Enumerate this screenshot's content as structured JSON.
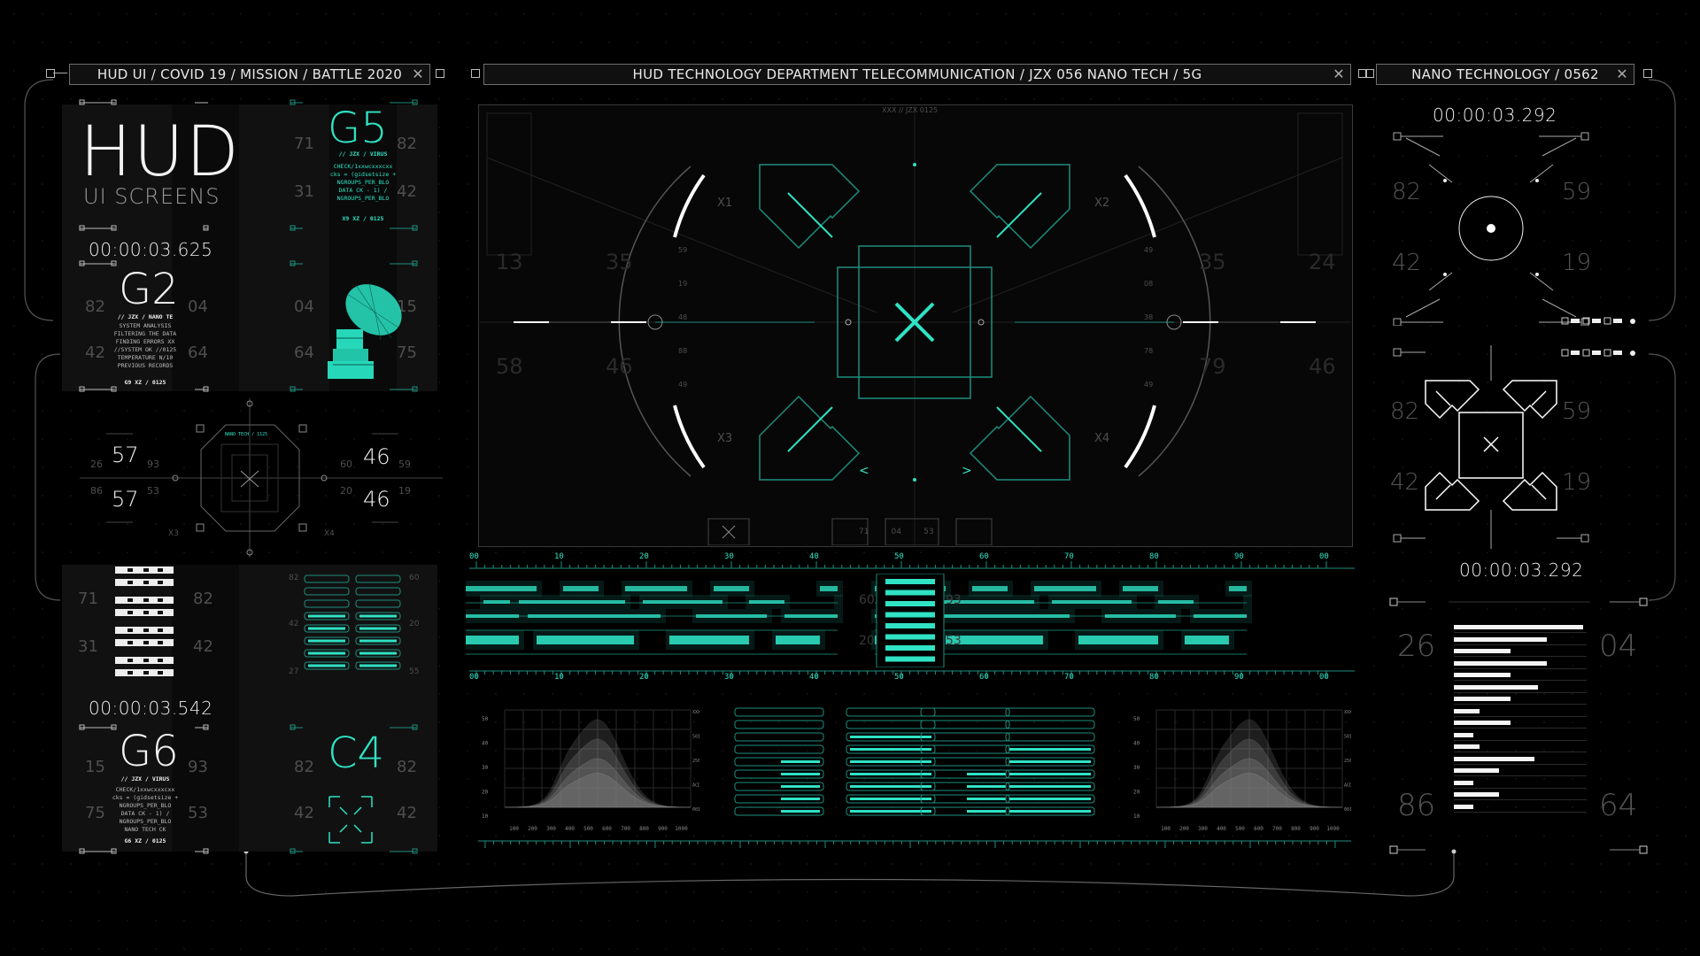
{
  "colors": {
    "accent": "#2fe3c4",
    "background": "#000000",
    "panel": "#111111",
    "text": "#e8e8e8",
    "muted": "#555555"
  },
  "top_bars": {
    "left": "HUD UI / COVID 19 /   MISSION / BATTLE 2020",
    "center": "HUD TECHNOLOGY  DEPARTMENT  TELECOMMUNICATION    /  JZX 056 NANO TECH / 5G",
    "right": "NANO TECHNOLOGY / 0562"
  },
  "left_panel_1": {
    "hud_title": "HUD",
    "hud_subtitle": "UI SCREENS",
    "g5_code": "G5",
    "g5_tag": "// JZX / VIRUS",
    "g5_lines": [
      "CHECK/1xxwcxxxcxx",
      "cks = (gidsetsize +",
      "NGROUPS_PER_BLO",
      "DATA CK - 1) /",
      "NGROUPS_PER_BLO"
    ],
    "g5_footer": "X9 XZ / 0125",
    "num_71": "71",
    "num_82a": "82",
    "num_31": "31",
    "num_42a": "42",
    "timer": "00:00:03.625",
    "g2_code": "G2",
    "g2_tag": "// JZX / NANO TE",
    "g2_lines": [
      "SYSTEM ANALYSIS",
      "FILTERING THE DATA",
      "FINDING ERRORS XX",
      "//SYSTEM OK //0125",
      "TEMPERATURE N/10",
      "PREVIOUS RECORDS"
    ],
    "g2_footer": "G9 XZ / 0125",
    "num_82b": "82",
    "num_04a": "04",
    "num_04b": "04",
    "num_15": "15",
    "num_42b": "42",
    "num_64a": "64",
    "num_64b": "64",
    "num_75": "75"
  },
  "left_panel_2": {
    "big_57a": "57",
    "big_57b": "57",
    "big_46a": "46",
    "big_46b": "46",
    "small_26": "26",
    "small_93": "93",
    "small_86": "86",
    "small_53": "53",
    "small_60": "60",
    "small_59": "59",
    "small_20": "20",
    "small_19": "19",
    "label_x3": "X3",
    "label_x4": "X4",
    "header": "NANO TECH / 1125"
  },
  "left_panel_3": {
    "num_71": "71",
    "num_82": "82",
    "num_31": "31",
    "num_42": "42",
    "timer": "00:00:03.542",
    "g6_code": "G6",
    "g6_tag": "// JZX / VIRUS",
    "g6_lines": [
      "CHECK/1xxwcxxxcxx",
      "cks = (gidsetsize +",
      "NGROUPS_PER_BLO",
      "DATA CK - 1) /",
      "NGROUPS_PER_BLO",
      "NANO TECH CK"
    ],
    "g6_footer": "G6 XZ / 0125",
    "c4_code": "C4",
    "num_15": "15",
    "num_93": "93",
    "num_75": "75",
    "num_53": "53",
    "num_82b": "82",
    "num_82c": "82",
    "num_42b": "42",
    "num_42c": "42",
    "sm_82": "82",
    "sm_60": "60",
    "sm_42": "42",
    "sm_20": "20",
    "sm_27": "27",
    "sm_55": "55",
    "level": 0.55
  },
  "center_view": {
    "header": "XXX // JZX 0125",
    "label_x1": "X1",
    "label_x2": "X2",
    "label_x3": "X3",
    "label_x4": "X4",
    "left_scale": [
      "59",
      "19",
      "48",
      "88",
      "49"
    ],
    "right_scale": [
      "49",
      "08",
      "38",
      "78",
      "49"
    ],
    "left_boxes": [
      "13",
      "35",
      "58",
      "46"
    ],
    "right_boxes": [
      "35",
      "24",
      "79",
      "46"
    ],
    "bottom_small": [
      "71",
      "04",
      "53"
    ],
    "arrow_left": "<",
    "arrow_right": ">"
  },
  "timeline": {
    "ticks": [
      "00",
      "10",
      "20",
      "30",
      "40",
      "50",
      "60",
      "70",
      "80",
      "90",
      "00"
    ],
    "mid_labels": [
      "60",
      "93",
      "20",
      "53"
    ]
  },
  "bottom_charts": {
    "x_ticks": [
      "100",
      "200",
      "300",
      "400",
      "500",
      "600",
      "700",
      "800",
      "900",
      "1000"
    ],
    "y_left": [
      "50",
      "40",
      "30",
      "20",
      "10"
    ],
    "y_right": [
      "XXX",
      "5015",
      "2500",
      "ACD1",
      "001**5"
    ],
    "scale_ticks": [
      "30",
      "40",
      "50",
      "60",
      "70",
      "80"
    ],
    "mid_small": [
      "50",
      "94",
      "57",
      "58",
      "59",
      "54"
    ]
  },
  "right_panel": {
    "timer_top": "00:00:03.292",
    "num_82a": "82",
    "num_59a": "59",
    "num_42a": "42",
    "num_19a": "19",
    "num_82b": "82",
    "num_59b": "59",
    "num_42b": "42",
    "num_19b": "19",
    "timer_bottom": "00:00:03.292",
    "num_26": "26",
    "num_04": "04",
    "num_86": "86",
    "num_64": "64",
    "bars": [
      1.0,
      0.72,
      0.44,
      0.72,
      0.44,
      0.65,
      0.44,
      0.2,
      0.44,
      0.15,
      0.2,
      0.62,
      0.35,
      0.15,
      0.35,
      0.15
    ]
  }
}
